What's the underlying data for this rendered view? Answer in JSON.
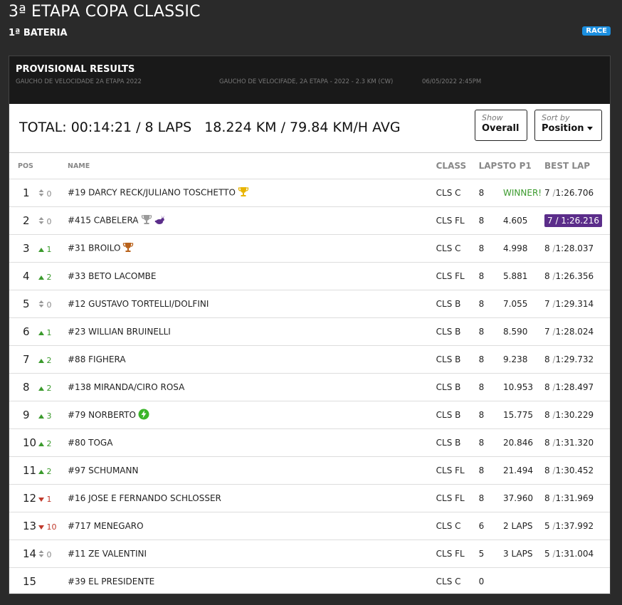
{
  "header": {
    "title": "3ª ETAPA COPA CLASSIC",
    "subtitle": "1ª BATERIA",
    "badge": "RACE"
  },
  "panel": {
    "title": "PROVISIONAL RESULTS",
    "event": "GAUCHO DE VELOCIDADE 2A ETAPA 2022",
    "track": "GAUCHO DE VELOCIFADE, 2A ETAPA - 2022 - 2.3 KM (CW)",
    "datetime": "06/05/2022 2:45PM"
  },
  "summary": {
    "total": "TOTAL: 00:14:21 / 8 LAPS",
    "distance": "18.224 KM / 79.84 KM/H AVG",
    "show_label": "Show",
    "show_value": "Overall",
    "sort_label": "Sort by",
    "sort_value": "Position"
  },
  "columns": {
    "pos": "POS",
    "name": "NAME",
    "class": "CLASS",
    "laps": "LAPS",
    "gap": "TO P1",
    "best": "BEST LAP"
  },
  "rows": [
    {
      "pos": "1",
      "delta": "0",
      "dir": "same",
      "name": "#19 DARCY RECK/JULIANO TOSCHETTO",
      "icon": "gold-trophy-icon",
      "class": "CLS C",
      "laps": "8",
      "gap": "WINNER!",
      "best_lap": "7",
      "best_time": "1:26.706",
      "best_purple": false
    },
    {
      "pos": "2",
      "delta": "0",
      "dir": "same",
      "name": "#415 CABELERA",
      "icon": "silver-trophy-icon",
      "icon2": "rabbit-icon",
      "class": "CLS FL",
      "laps": "8",
      "gap": "4.605",
      "best_lap": "7",
      "best_time": "1:26.216",
      "best_purple": true
    },
    {
      "pos": "3",
      "delta": "1",
      "dir": "up",
      "name": "#31 BROILO",
      "icon": "bronze-trophy-icon",
      "class": "CLS C",
      "laps": "8",
      "gap": "4.998",
      "best_lap": "8",
      "best_time": "1:28.037",
      "best_purple": false
    },
    {
      "pos": "4",
      "delta": "2",
      "dir": "up",
      "name": "#33 BETO LACOMBE",
      "class": "CLS FL",
      "laps": "8",
      "gap": "5.881",
      "best_lap": "8",
      "best_time": "1:26.356",
      "best_purple": false
    },
    {
      "pos": "5",
      "delta": "0",
      "dir": "same",
      "name": "#12 GUSTAVO TORTELLI/DOLFINI",
      "class": "CLS B",
      "laps": "8",
      "gap": "7.055",
      "best_lap": "7",
      "best_time": "1:29.314",
      "best_purple": false
    },
    {
      "pos": "6",
      "delta": "1",
      "dir": "up",
      "name": "#23 WILLIAN BRUINELLI",
      "class": "CLS B",
      "laps": "8",
      "gap": "8.590",
      "best_lap": "7",
      "best_time": "1:28.024",
      "best_purple": false
    },
    {
      "pos": "7",
      "delta": "2",
      "dir": "up",
      "name": "#88 FIGHERA",
      "class": "CLS B",
      "laps": "8",
      "gap": "9.238",
      "best_lap": "8",
      "best_time": "1:29.732",
      "best_purple": false
    },
    {
      "pos": "8",
      "delta": "2",
      "dir": "up",
      "name": "#138 MIRANDA/CIRO ROSA",
      "class": "CLS B",
      "laps": "8",
      "gap": "10.953",
      "best_lap": "8",
      "best_time": "1:28.497",
      "best_purple": false
    },
    {
      "pos": "9",
      "delta": "3",
      "dir": "up",
      "name": "#79 NORBERTO",
      "icon": "lightning-icon",
      "class": "CLS B",
      "laps": "8",
      "gap": "15.775",
      "best_lap": "8",
      "best_time": "1:30.229",
      "best_purple": false
    },
    {
      "pos": "10",
      "delta": "2",
      "dir": "up",
      "name": "#80 TOGA",
      "class": "CLS B",
      "laps": "8",
      "gap": "20.846",
      "best_lap": "8",
      "best_time": "1:31.320",
      "best_purple": false
    },
    {
      "pos": "11",
      "delta": "2",
      "dir": "up",
      "name": "#97 SCHUMANN",
      "class": "CLS FL",
      "laps": "8",
      "gap": "21.494",
      "best_lap": "8",
      "best_time": "1:30.452",
      "best_purple": false
    },
    {
      "pos": "12",
      "delta": "1",
      "dir": "down",
      "name": "#16 JOSE E FERNANDO SCHLOSSER",
      "class": "CLS FL",
      "laps": "8",
      "gap": "37.960",
      "best_lap": "8",
      "best_time": "1:31.969",
      "best_purple": false
    },
    {
      "pos": "13",
      "delta": "10",
      "dir": "down",
      "name": "#717 MENEGARO",
      "class": "CLS C",
      "laps": "6",
      "gap": "2 LAPS",
      "best_lap": "5",
      "best_time": "1:37.992",
      "best_purple": false
    },
    {
      "pos": "14",
      "delta": "0",
      "dir": "same",
      "name": "#11 ZE VALENTINI",
      "class": "CLS FL",
      "laps": "5",
      "gap": "3 LAPS",
      "best_lap": "5",
      "best_time": "1:31.004",
      "best_purple": false
    },
    {
      "pos": "15",
      "delta": "",
      "dir": "none",
      "name": "#39 EL PRESIDENTE",
      "class": "CLS C",
      "laps": "0",
      "gap": "",
      "best_lap": "",
      "best_time": "",
      "best_purple": false
    }
  ],
  "colors": {
    "background": "#2a2a2a",
    "panel_header": "#191919",
    "badge": "#1b8fe0",
    "up": "#3a9a2c",
    "down": "#c0392b",
    "purple_best": "#5b2d8a",
    "gold": "#e8b400",
    "silver": "#9a9a9a",
    "bronze": "#b8621b",
    "green_bolt": "#3bb52a"
  }
}
